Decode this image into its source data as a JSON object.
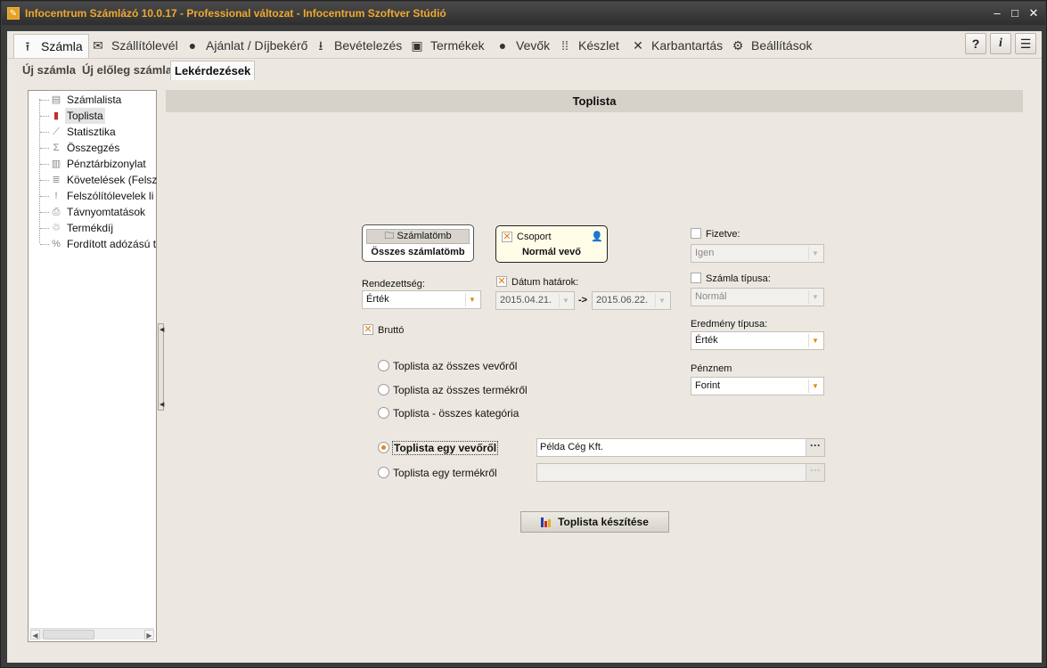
{
  "window": {
    "title": "Infocentrum Számlázó 10.0.17 - Professional változat - Infocentrum Szoftver Stúdió"
  },
  "menu": {
    "items": [
      {
        "label": "Számla",
        "icon": "upload-icon"
      },
      {
        "label": "Szállítólevél",
        "icon": "envelope-icon"
      },
      {
        "label": "Ajánlat / Díjbekérő",
        "icon": "handshake-icon"
      },
      {
        "label": "Bevételezés",
        "icon": "download-icon"
      },
      {
        "label": "Termékek",
        "icon": "box-icon"
      },
      {
        "label": "Vevők",
        "icon": "user-icon"
      },
      {
        "label": "Készlet",
        "icon": "grid-icon"
      },
      {
        "label": "Karbantartás",
        "icon": "tools-icon"
      },
      {
        "label": "Beállítások",
        "icon": "gear-icon"
      }
    ],
    "help_label": "?",
    "info_label": "i",
    "list_label": "☰"
  },
  "subtabs": [
    "Új számla",
    "Új előleg számla",
    "Lekérdezések"
  ],
  "tree": {
    "items": [
      "Számlalista",
      "Toplista",
      "Statisztika",
      "Összegzés",
      "Pénztárbizonylat",
      "Követelések (Felsz",
      "Felszólítólevelek li",
      "Távnyomtatások",
      "Termékdíj",
      "Fordított adózású t"
    ]
  },
  "form": {
    "header": "Toplista",
    "szamlatomb_btn": "Számlatömb",
    "szamlatomb_value": "Összes számlatömb",
    "csoport_label": "Csoport",
    "csoport_value": "Normál vevő",
    "rendezettseg_label": "Rendezettség:",
    "rendezettseg_value": "Érték",
    "datum_label": "Dátum határok:",
    "date_from": "2015.04.21.",
    "date_to": "2015.06.22.",
    "date_sep": "->",
    "brutto_label": "Bruttó",
    "fizetve_label": "Fizetve:",
    "fizetve_value": "Igen",
    "szamla_tipusa_label": "Számla típusa:",
    "szamla_tipusa_value": "Normál",
    "eredmeny_label": "Eredmény típusa:",
    "eredmeny_value": "Érték",
    "penznem_label": "Pénznem",
    "penznem_value": "Forint",
    "radios": [
      "Toplista az összes vevőről",
      "Toplista az összes termékről",
      "Toplista - összes kategória",
      "Toplista egy vevőről",
      "Toplista egy termékről"
    ],
    "selected_radio": "Toplista egy vevőről",
    "vevo_value": "Példa Cég Kft.",
    "termek_value": "",
    "dots": "···",
    "action_label": "Toplista készítése"
  },
  "colors": {
    "title_text": "#f0a830",
    "accent": "#e8841a"
  }
}
